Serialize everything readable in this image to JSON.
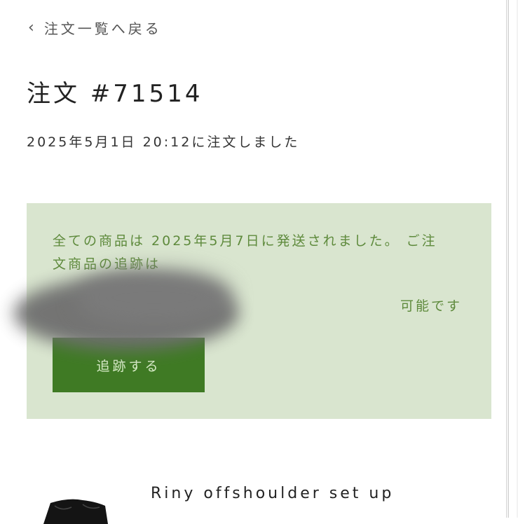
{
  "nav": {
    "back_icon": "chevron-left-icon",
    "back_label": "注文一覧へ戻る"
  },
  "order": {
    "title": "注文 #71514",
    "ordered_at": "2025年5月1日 20:12に注文しました"
  },
  "shipment": {
    "message": "全ての商品は 2025年5月7日に発送されました。 ご注文商品の追跡は",
    "availability": "可能です",
    "track_button": "追跡する",
    "colors": {
      "panel_bg": "#d9e5cf",
      "text": "#5e8a3c",
      "button_bg": "#3f7a24"
    }
  },
  "product": {
    "name": "Riny offshoulder set up"
  }
}
